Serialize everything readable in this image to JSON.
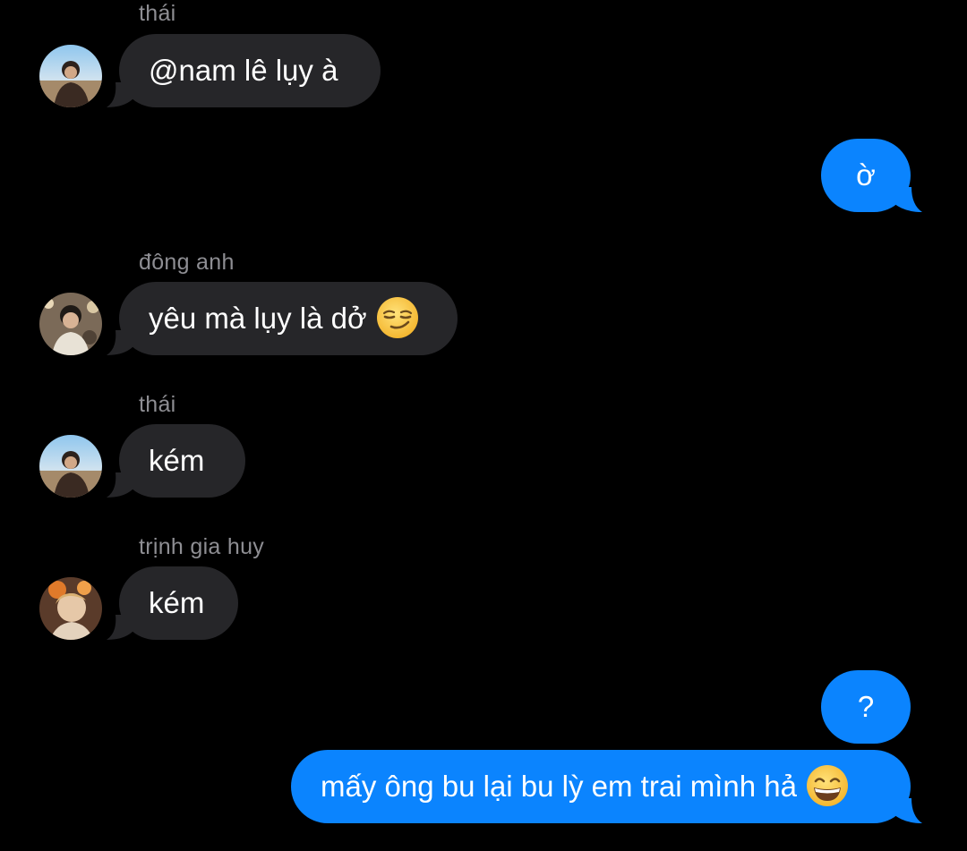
{
  "messages": [
    {
      "sender": "thái",
      "text": "@nam lê lụy à",
      "avatar": "avatar-thai"
    },
    {
      "outgoing": true,
      "text": "ờ"
    },
    {
      "sender": "đông anh",
      "text": "yêu mà lụy là dở",
      "emoji": "smirking-face-emoji",
      "avatar": "avatar-dong-anh"
    },
    {
      "sender": "thái",
      "text": "kém",
      "avatar": "avatar-thai"
    },
    {
      "sender": "trịnh gia huy",
      "text": "kém",
      "avatar": "avatar-trinh-gia-huy"
    },
    {
      "outgoing": true,
      "text": "?"
    },
    {
      "outgoing": true,
      "text": "mấy ông bu lại bu lỳ em trai mình hả",
      "emoji": "grinning-face-emoji"
    }
  ],
  "colors": {
    "background": "#000000",
    "incoming_bubble": "#262629",
    "outgoing_bubble": "#0b84fe",
    "sender_name": "#8e8e93",
    "text": "#ffffff"
  }
}
